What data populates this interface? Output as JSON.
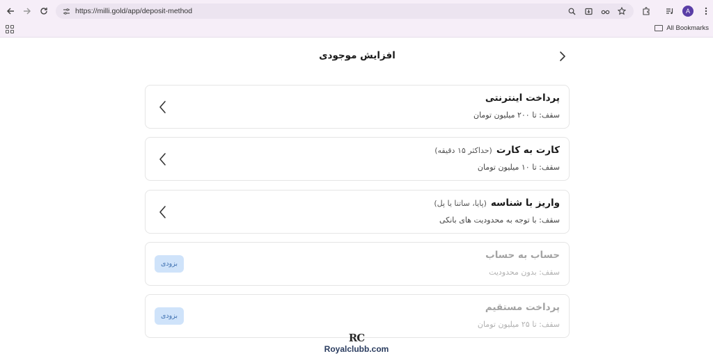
{
  "browser": {
    "url": "https://milli.gold/app/deposit-method",
    "avatar_letter": "A",
    "all_bookmarks_label": "All Bookmarks"
  },
  "page": {
    "title": "افزایش موجودی"
  },
  "methods": [
    {
      "title": "پرداخت اینترنتی",
      "note": "",
      "limit": "سقف: تا ۲۰۰ میلیون تومان"
    },
    {
      "title": "کارت به کارت",
      "note": "(حداکثر ۱۵ دقیقه)",
      "limit": "سقف: تا ۱۰ میلیون تومان"
    },
    {
      "title": "واریز با شناسه",
      "note": "(پایا، ساتنا یا پل)",
      "limit": "سقف: با توجه به محدودیت های بانکی"
    },
    {
      "title": "حساب به حساب",
      "note": "",
      "limit": "سقف: بدون محدودیت",
      "badge": "بزودی"
    },
    {
      "title": "پرداخت مستقیم",
      "note": "",
      "limit": "سقف: تا ۲۵ میلیون تومان",
      "badge": "بزودی"
    }
  ],
  "watermark": {
    "logo": "RC",
    "text": "Royalclubb.com"
  }
}
